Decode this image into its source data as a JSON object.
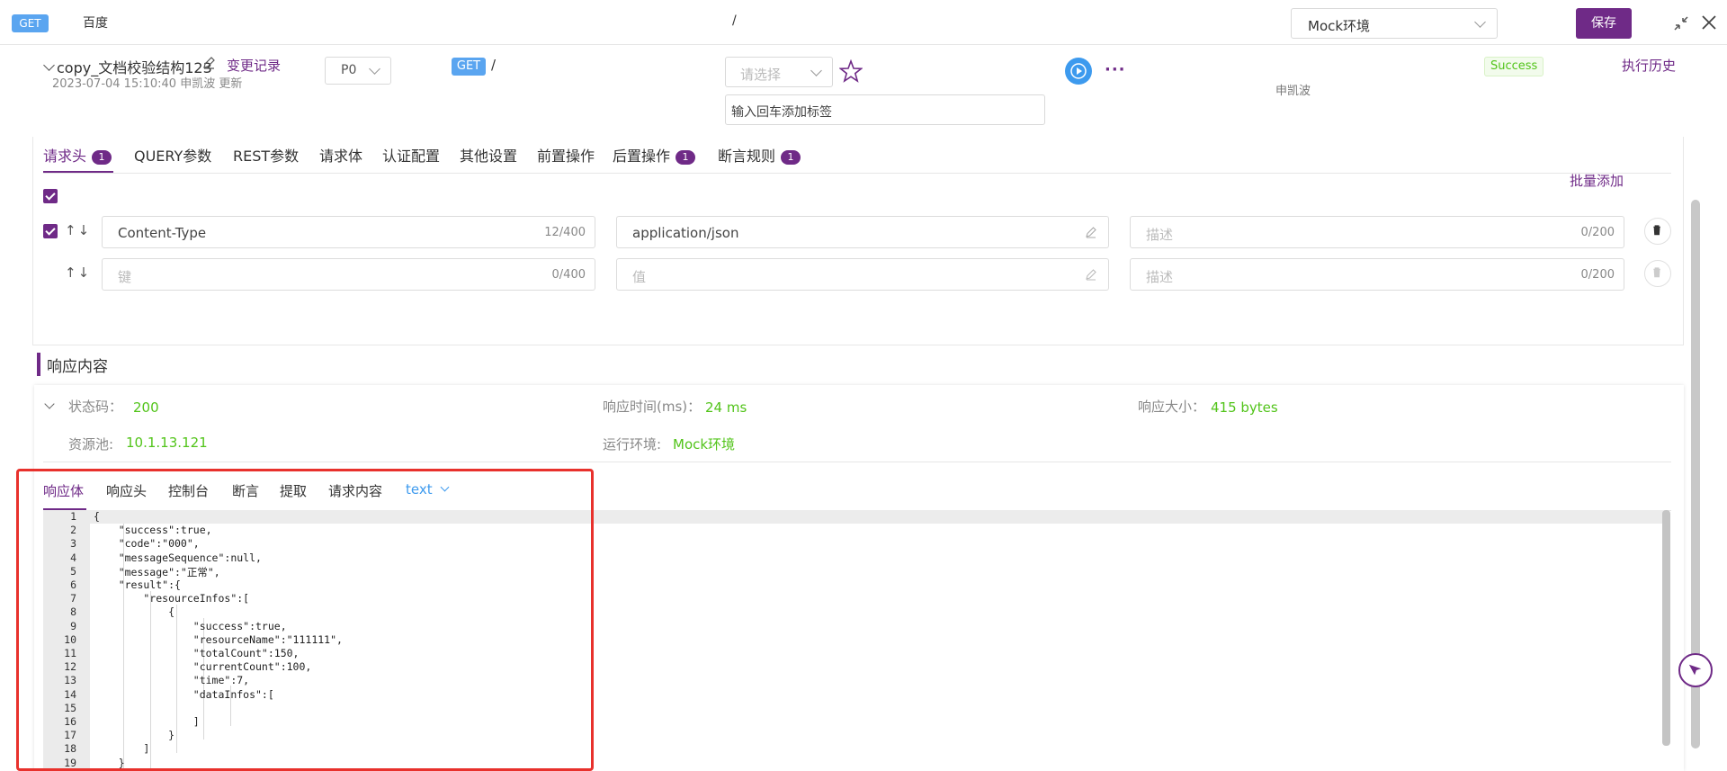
{
  "topbar": {
    "method": "GET",
    "title": "百度",
    "path": "/",
    "env": "Mock环境",
    "save_label": "保存"
  },
  "api": {
    "name": "copy_文档校验结构123",
    "change_log": "变更记录",
    "updated": "2023-07-04 15:10:40 申凯波 更新",
    "priority": "P0",
    "method": "GET",
    "path": "/",
    "tag_select_placeholder": "请选择",
    "tag_input_placeholder": "输入回车添加标签",
    "runner": "申凯波",
    "status": "Success",
    "history": "执行历史"
  },
  "request_tabs": [
    {
      "label": "请求头",
      "badge": "1"
    },
    {
      "label": "QUERY参数",
      "badge": ""
    },
    {
      "label": "REST参数",
      "badge": ""
    },
    {
      "label": "请求体",
      "badge": ""
    },
    {
      "label": "认证配置",
      "badge": ""
    },
    {
      "label": "其他设置",
      "badge": ""
    },
    {
      "label": "前置操作",
      "badge": ""
    },
    {
      "label": "后置操作",
      "badge": "1"
    },
    {
      "label": "断言规则",
      "badge": "1"
    }
  ],
  "bulk_add": "批量添加",
  "headers": [
    {
      "key": "Content-Type",
      "key_count": "12/400",
      "value": "application/json",
      "desc_placeholder": "描述",
      "desc_count": "0/200"
    },
    {
      "key_placeholder": "键",
      "key_count": "0/400",
      "value_placeholder": "值",
      "desc_placeholder": "描述",
      "desc_count": "0/200"
    }
  ],
  "response": {
    "heading": "响应内容",
    "status_label": "状态码：",
    "status": "200",
    "time_label": "响应时间(ms)：",
    "time": "24 ms",
    "size_label": "响应大小：",
    "size": "415 bytes",
    "pool_label": "资源池:",
    "pool": "10.1.13.121",
    "env_label": "运行环境:",
    "env": "Mock环境",
    "tabs": [
      "响应体",
      "响应头",
      "控制台",
      "断言",
      "提取",
      "请求内容"
    ],
    "format": "text"
  },
  "code_lines": [
    "{",
    "    \"success\":true,",
    "    \"code\":\"000\",",
    "    \"messageSequence\":null,",
    "    \"message\":\"正常\",",
    "    \"result\":{",
    "        \"resourceInfos\":[",
    "            {",
    "                \"success\":true,",
    "                \"resourceName\":\"111111\",",
    "                \"totalCount\":150,",
    "                \"currentCount\":100,",
    "                \"time\":7,",
    "                \"dataInfos\":[",
    "",
    "                ]",
    "            }",
    "        ]",
    "    }"
  ],
  "line_numbers": [
    "1",
    "2",
    "3",
    "4",
    "5",
    "6",
    "7",
    "8",
    "9",
    "10",
    "11",
    "12",
    "13",
    "14",
    "15",
    "16",
    "17",
    "18",
    "19"
  ]
}
